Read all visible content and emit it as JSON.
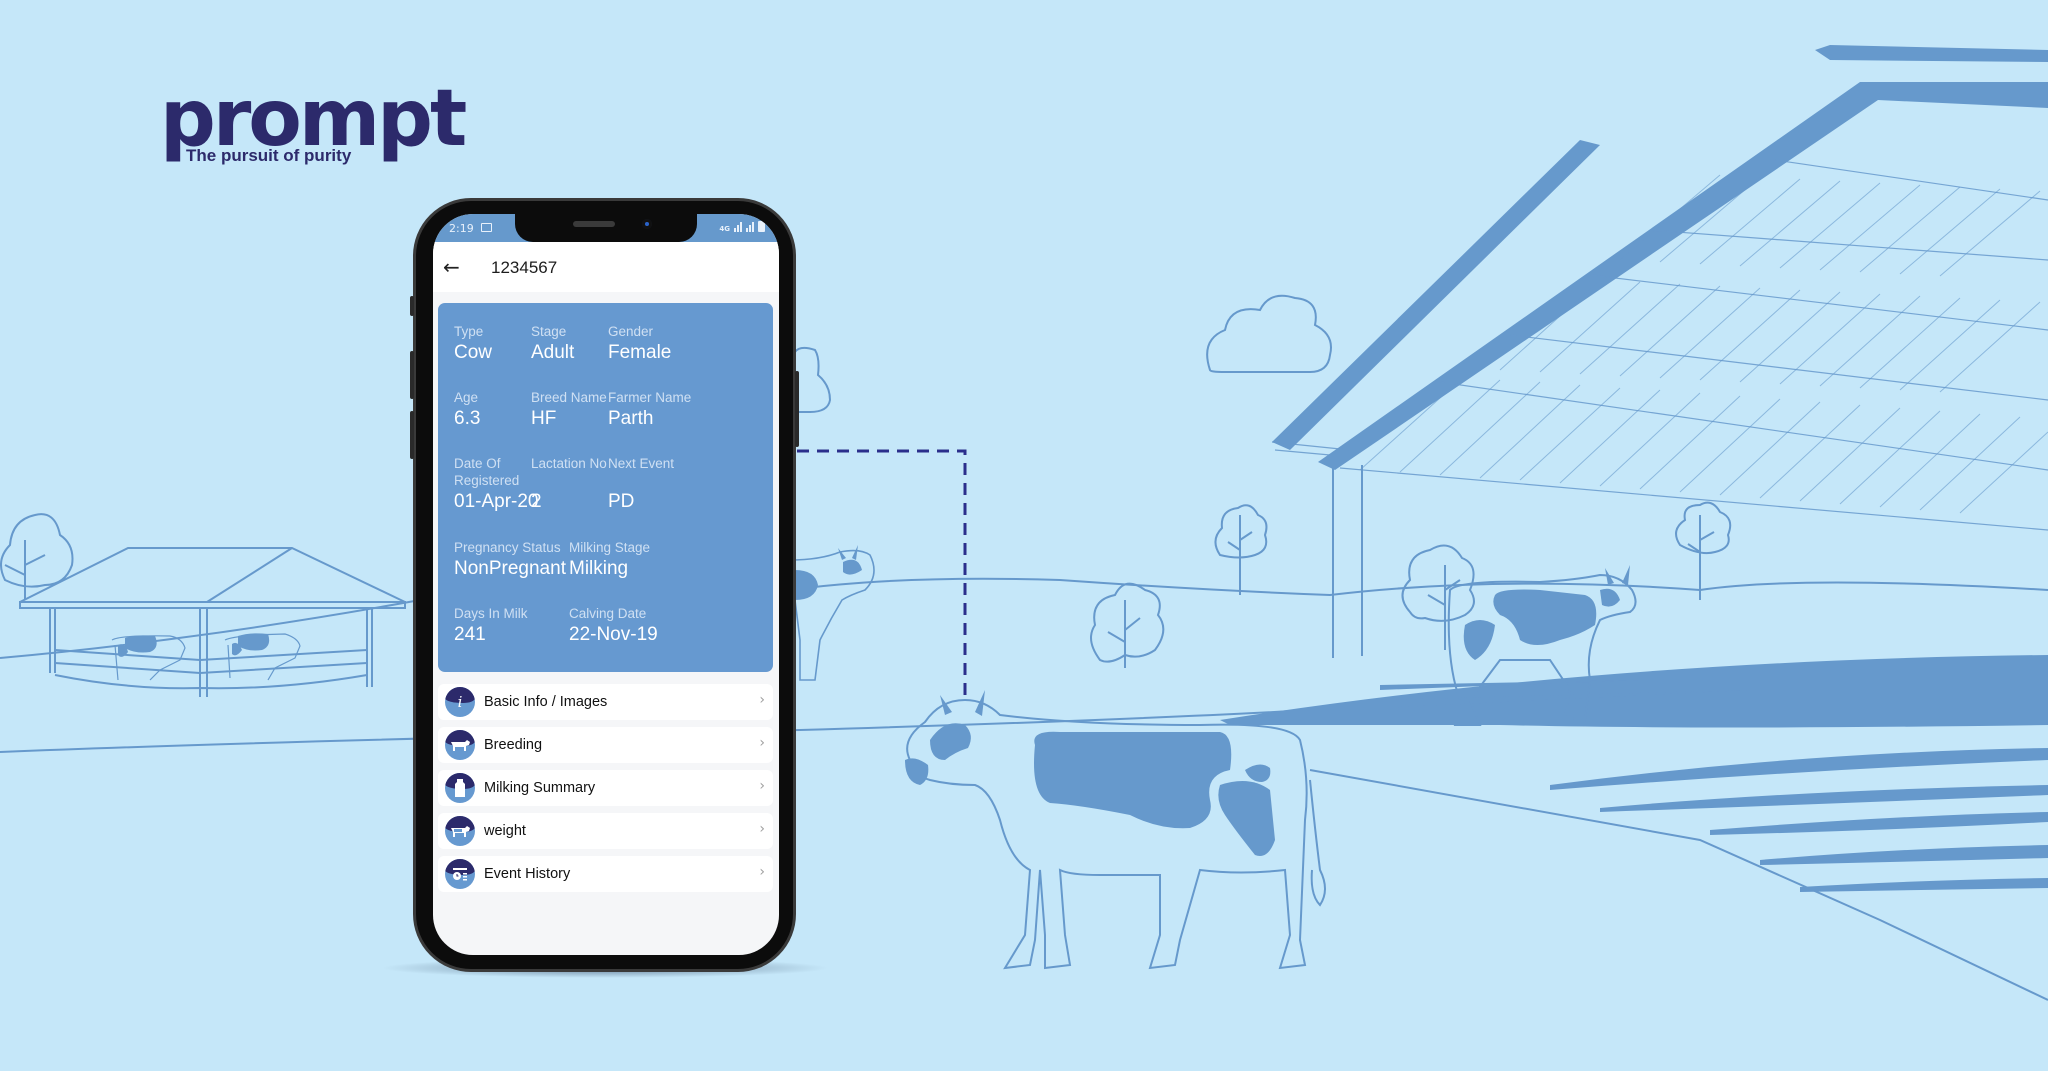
{
  "brand": {
    "name": "prompt",
    "tagline": "The pursuit of purity",
    "color": "#2c2a6b"
  },
  "colors": {
    "background": "#c5e7f9",
    "illustration": "#6699cc",
    "card": "#6699d0",
    "connector": "#2b2f8c"
  },
  "status_bar": {
    "time": "2:19",
    "network": "4G"
  },
  "app_bar": {
    "back_icon": "arrow-left-icon",
    "title": "1234567"
  },
  "details": {
    "type": {
      "label": "Type",
      "value": "Cow"
    },
    "stage": {
      "label": "Stage",
      "value": "Adult"
    },
    "gender": {
      "label": "Gender",
      "value": "Female"
    },
    "age": {
      "label": "Age",
      "value": "6.3"
    },
    "breed": {
      "label": "Breed Name",
      "value": "HF"
    },
    "farmer": {
      "label": "Farmer Name",
      "value": "Parth"
    },
    "registered": {
      "label1": "Date Of",
      "label2": "Registered",
      "value": "01-Apr-20"
    },
    "lactation": {
      "label": "Lactation No",
      "value": "2"
    },
    "next_event": {
      "label": "Next Event",
      "value": "PD"
    },
    "pregnancy": {
      "label": "Pregnancy Status",
      "value": "NonPregnant"
    },
    "milking_stage": {
      "label": "Milking Stage",
      "value": "Milking"
    },
    "days_in_milk": {
      "label": "Days In Milk",
      "value": "241"
    },
    "calving": {
      "label": "Calving Date",
      "value": "22-Nov-19"
    }
  },
  "menu": [
    {
      "label": "Basic Info / Images",
      "icon": "info-icon"
    },
    {
      "label": "Breeding",
      "icon": "cow-icon"
    },
    {
      "label": "Milking Summary",
      "icon": "milk-can-icon"
    },
    {
      "label": "weight",
      "icon": "cow-weight-icon"
    },
    {
      "label": "Event History",
      "icon": "clock-history-icon"
    }
  ],
  "chevron": "›"
}
